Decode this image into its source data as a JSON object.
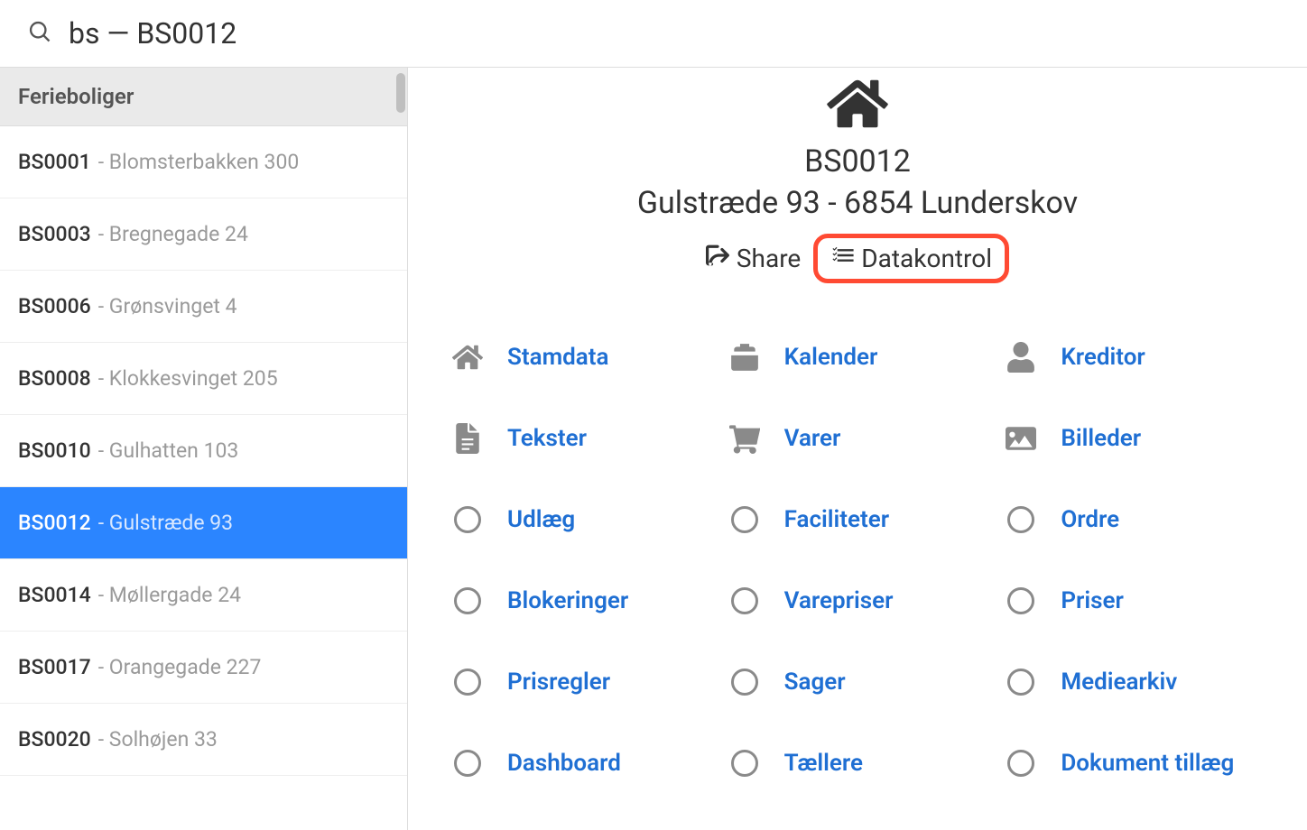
{
  "search": {
    "value": "bs — BS0012"
  },
  "sidebar": {
    "header": "Ferieboliger",
    "items": [
      {
        "code": "BS0001",
        "name": "- Blomsterbakken 300",
        "selected": false
      },
      {
        "code": "BS0003",
        "name": "- Bregnegade 24",
        "selected": false
      },
      {
        "code": "BS0006",
        "name": "- Grønsvinget 4",
        "selected": false
      },
      {
        "code": "BS0008",
        "name": "- Klokkesvinget 205",
        "selected": false
      },
      {
        "code": "BS0010",
        "name": "- Gulhatten 103",
        "selected": false
      },
      {
        "code": "BS0012",
        "name": "- Gulstræde 93",
        "selected": true
      },
      {
        "code": "BS0014",
        "name": "- Møllergade 24",
        "selected": false
      },
      {
        "code": "BS0017",
        "name": "- Orangegade 227",
        "selected": false
      },
      {
        "code": "BS0020",
        "name": "- Solhøjen 33",
        "selected": false
      }
    ]
  },
  "main": {
    "code": "BS0012",
    "address": "Gulstræde 93 - 6854 Lunderskov",
    "share_label": "Share",
    "datakontrol_label": "Datakontrol"
  },
  "nav": {
    "items": [
      {
        "label": "Stamdata",
        "icon": "home"
      },
      {
        "label": "Kalender",
        "icon": "calendar"
      },
      {
        "label": "Kreditor",
        "icon": "user"
      },
      {
        "label": "Tekster",
        "icon": "document"
      },
      {
        "label": "Varer",
        "icon": "cart"
      },
      {
        "label": "Billeder",
        "icon": "image"
      },
      {
        "label": "Udlæg",
        "icon": "circle"
      },
      {
        "label": "Faciliteter",
        "icon": "circle"
      },
      {
        "label": "Ordre",
        "icon": "circle"
      },
      {
        "label": "Blokeringer",
        "icon": "circle"
      },
      {
        "label": "Varepriser",
        "icon": "circle"
      },
      {
        "label": "Priser",
        "icon": "circle"
      },
      {
        "label": "Prisregler",
        "icon": "circle"
      },
      {
        "label": "Sager",
        "icon": "circle"
      },
      {
        "label": "Mediearkiv",
        "icon": "circle"
      },
      {
        "label": "Dashboard",
        "icon": "circle"
      },
      {
        "label": "Tællere",
        "icon": "circle"
      },
      {
        "label": "Dokument tillæg",
        "icon": "circle"
      }
    ]
  }
}
